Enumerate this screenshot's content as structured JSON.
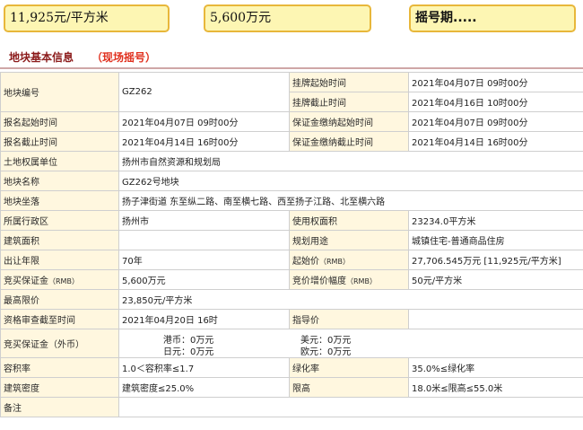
{
  "summary": {
    "price": "11,925元/平方米",
    "deposit": "5,600万元",
    "status": "摇号期....."
  },
  "section": {
    "title": "地块基本信息",
    "note": "（现场摇号）"
  },
  "rows": {
    "parcel_no": {
      "label": "地块编号",
      "value": "GZ262"
    },
    "listing_start": {
      "label": "挂牌起始时间",
      "value": "2021年04月07日 09时00分"
    },
    "listing_end": {
      "label": "挂牌截止时间",
      "value": "2021年04月16日 10时00分"
    },
    "reg_start": {
      "label": "报名起始时间",
      "value": "2021年04月07日 09时00分"
    },
    "deposit_start": {
      "label": "保证金缴纳起始时间",
      "value": "2021年04月07日 09时00分"
    },
    "reg_end": {
      "label": "报名截止时间",
      "value": "2021年04月14日 16时00分"
    },
    "deposit_end": {
      "label": "保证金缴纳截止时间",
      "value": "2021年04月14日 16时00分"
    },
    "owner": {
      "label": "土地权属单位",
      "value": "扬州市自然资源和规划局"
    },
    "name": {
      "label": "地块名称",
      "value": "GZ262号地块"
    },
    "location": {
      "label": "地块坐落",
      "value": "扬子津街道 东至纵二路、南至横七路、西至扬子江路、北至横六路"
    },
    "district": {
      "label": "所属行政区",
      "value": "扬州市"
    },
    "use_area": {
      "label": "使用权面积",
      "value": "23234.0平方米"
    },
    "build_area": {
      "label": "建筑面积",
      "value": ""
    },
    "purpose": {
      "label": "规划用途",
      "value": "城镇住宅-普通商品住房"
    },
    "term": {
      "label": "出让年限",
      "value": "70年"
    },
    "start_price": {
      "label": "起始价",
      "unit": "（RMB）",
      "value": "27,706.545万元 [11,925元/平方米]"
    },
    "bid_deposit": {
      "label": "竞买保证金",
      "unit": "（RMB）",
      "value": "5,600万元"
    },
    "increment": {
      "label": "竞价增价幅度",
      "unit": "（RMB）",
      "value": "50元/平方米"
    },
    "max_price": {
      "label": "最高限价",
      "value": "23,850元/平方米"
    },
    "review_deadline": {
      "label": "资格审查截至时间",
      "value": "2021年04月20日 16时"
    },
    "guide_price": {
      "label": "指导价",
      "value": ""
    },
    "fx_deposit": {
      "label": "竞买保证金（外币）",
      "hkd": "港币：0万元",
      "usd": "美元：0万元",
      "jpy": "日元：0万元",
      "eur": "欧元：0万元"
    },
    "far": {
      "label": "容积率",
      "value": "1.0＜容积率≤1.7"
    },
    "green": {
      "label": "绿化率",
      "value": "35.0%≤绿化率"
    },
    "density": {
      "label": "建筑密度",
      "value": "建筑密度≤25.0%"
    },
    "height": {
      "label": "限高",
      "value": "18.0米≤限高≤55.0米"
    },
    "remark": {
      "label": "备注",
      "value": ""
    }
  }
}
